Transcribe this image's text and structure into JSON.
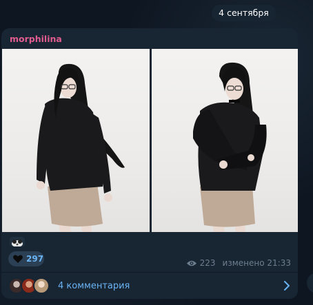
{
  "date_separator": "4 сентября",
  "post": {
    "author": "morphilina",
    "reactions": {
      "emoji_icon": "cat-emoji-icon",
      "likes_icon": "heart-icon",
      "likes_count": "297"
    },
    "views": "223",
    "edited_label": "изменено",
    "time": "21:33",
    "comments_label": "4 комментария"
  },
  "colors": {
    "background": "#0e1621",
    "bubble": "#182533",
    "author": "#e05c8f",
    "link": "#6ab3f3",
    "meta": "#6d7f8f"
  }
}
